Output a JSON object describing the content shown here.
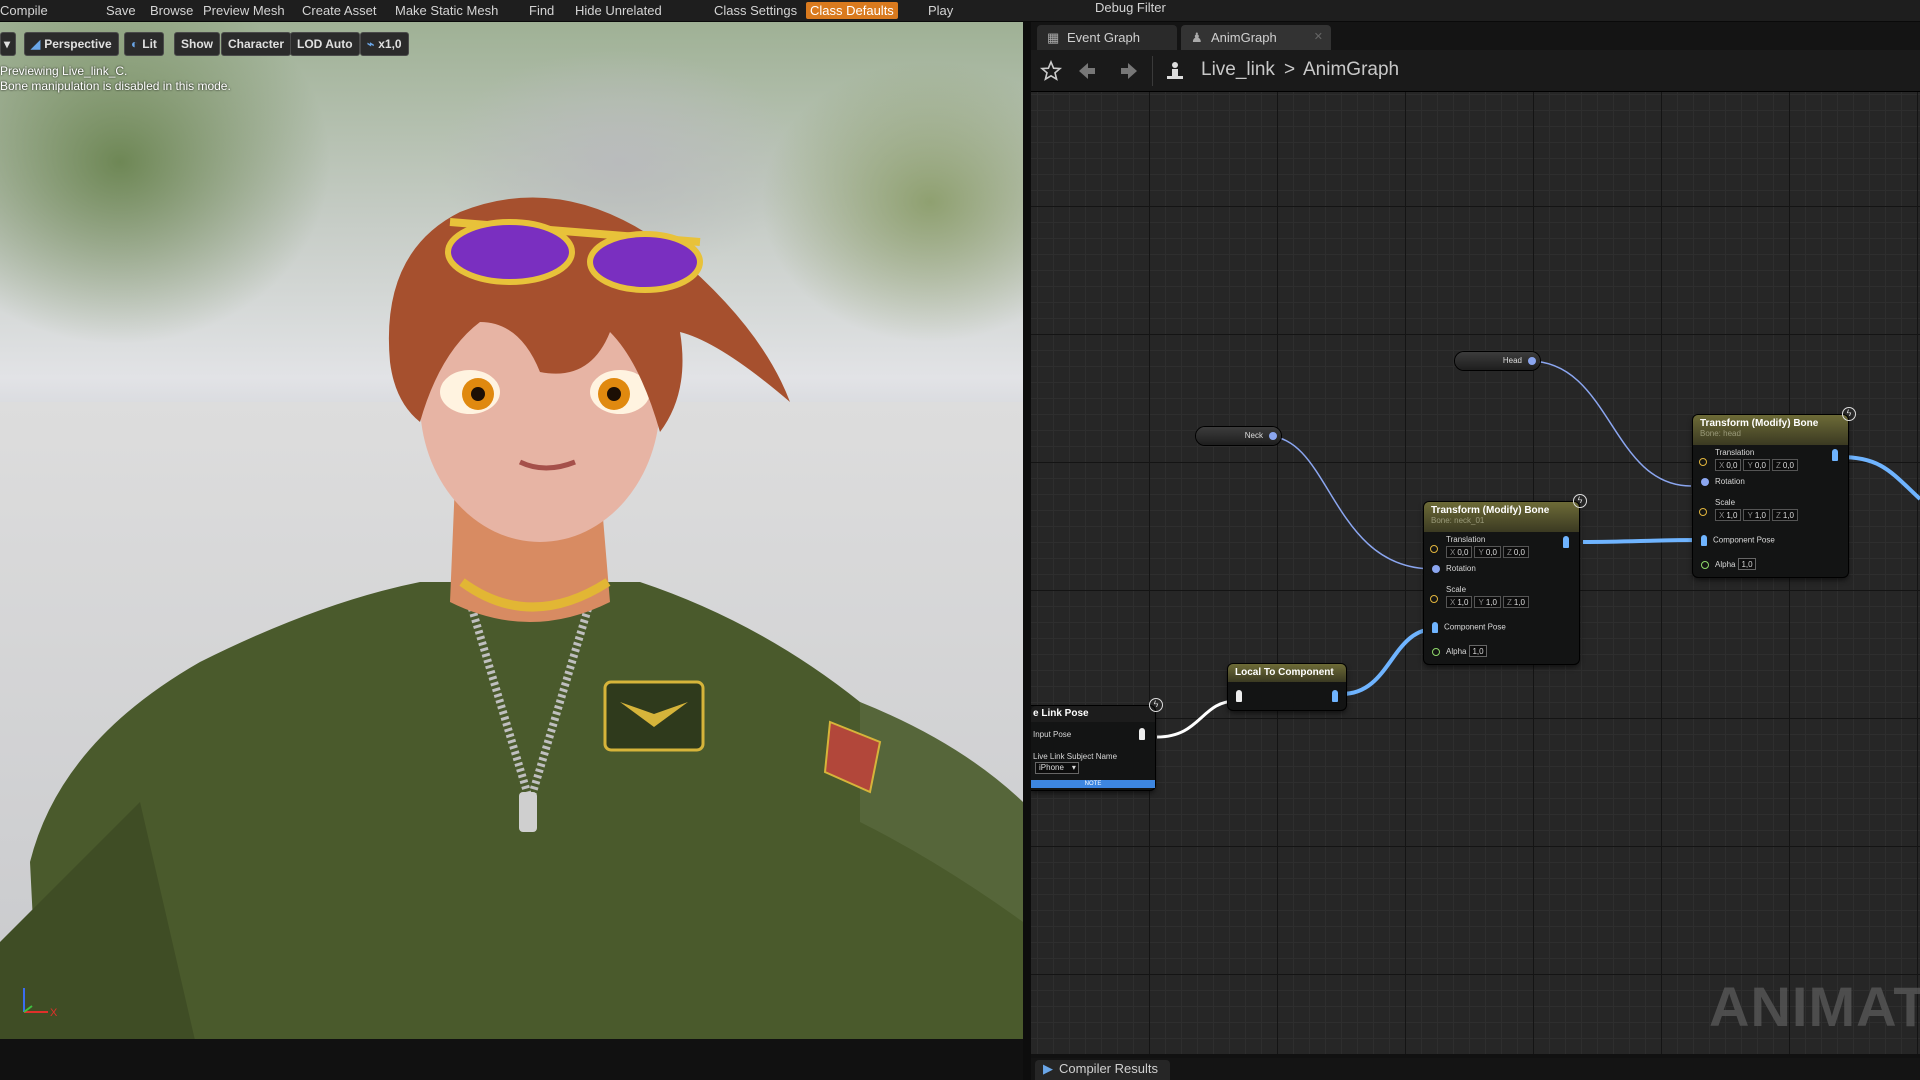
{
  "toolbar": {
    "compile": "Compile",
    "save": "Save",
    "browse": "Browse",
    "preview_mesh": "Preview Mesh",
    "create_asset": "Create Asset",
    "make_static_mesh": "Make Static Mesh",
    "find": "Find",
    "hide_unrelated": "Hide Unrelated",
    "class_settings": "Class Settings",
    "class_defaults": "Class Defaults",
    "play": "Play",
    "debug_filter": "Debug Filter"
  },
  "viewport": {
    "buttons": {
      "perspective": "Perspective",
      "lit": "Lit",
      "show": "Show",
      "character": "Character",
      "lod": "LOD Auto",
      "speed": "x1,0"
    },
    "info_line1": "Previewing Live_link_C.",
    "info_line2": "Bone manipulation is disabled in this mode.",
    "axis_label": "X"
  },
  "tabs": {
    "event_graph": "Event Graph",
    "anim_graph": "AnimGraph"
  },
  "breadcrumb": {
    "root": "Live_link",
    "separator": ">",
    "current": "AnimGraph"
  },
  "nodes": {
    "head_var": "Head",
    "neck_var": "Neck",
    "tm_neck": {
      "title": "Transform (Modify) Bone",
      "subtitle": "Bone: neck_01",
      "translation": "Translation",
      "rotation": "Rotation",
      "scale": "Scale",
      "component_pose": "Component Pose",
      "alpha": "Alpha",
      "alpha_value": "1,0",
      "t_values": [
        "0,0",
        "0,0",
        "0,0"
      ],
      "s_values": [
        "1,0",
        "1,0",
        "1,0"
      ]
    },
    "tm_head": {
      "title": "Transform (Modify) Bone",
      "subtitle": "Bone: head",
      "translation": "Translation",
      "rotation": "Rotation",
      "scale": "Scale",
      "component_pose": "Component Pose",
      "alpha": "Alpha",
      "alpha_value": "1,0",
      "t_values": [
        "0,0",
        "0,0",
        "0,0"
      ],
      "s_values": [
        "1,0",
        "1,0",
        "1,0"
      ]
    },
    "axis_letters": [
      "X",
      "Y",
      "Z"
    ],
    "local_to_component": "Local To Component",
    "live_link_pose": {
      "title": "e Link Pose",
      "input_pose": "Input Pose",
      "subject_name_label": "Live Link Subject Name",
      "subject_value": "iPhone",
      "note": "NOTE"
    }
  },
  "watermark": "ANIMAT",
  "compiler_results": "Compiler Results",
  "colors": {
    "accent_orange": "#d97a1e",
    "pose_wire": "#6fb4ff",
    "rotation_wire": "#8ba6f0",
    "node_header": "#6d6b37"
  }
}
